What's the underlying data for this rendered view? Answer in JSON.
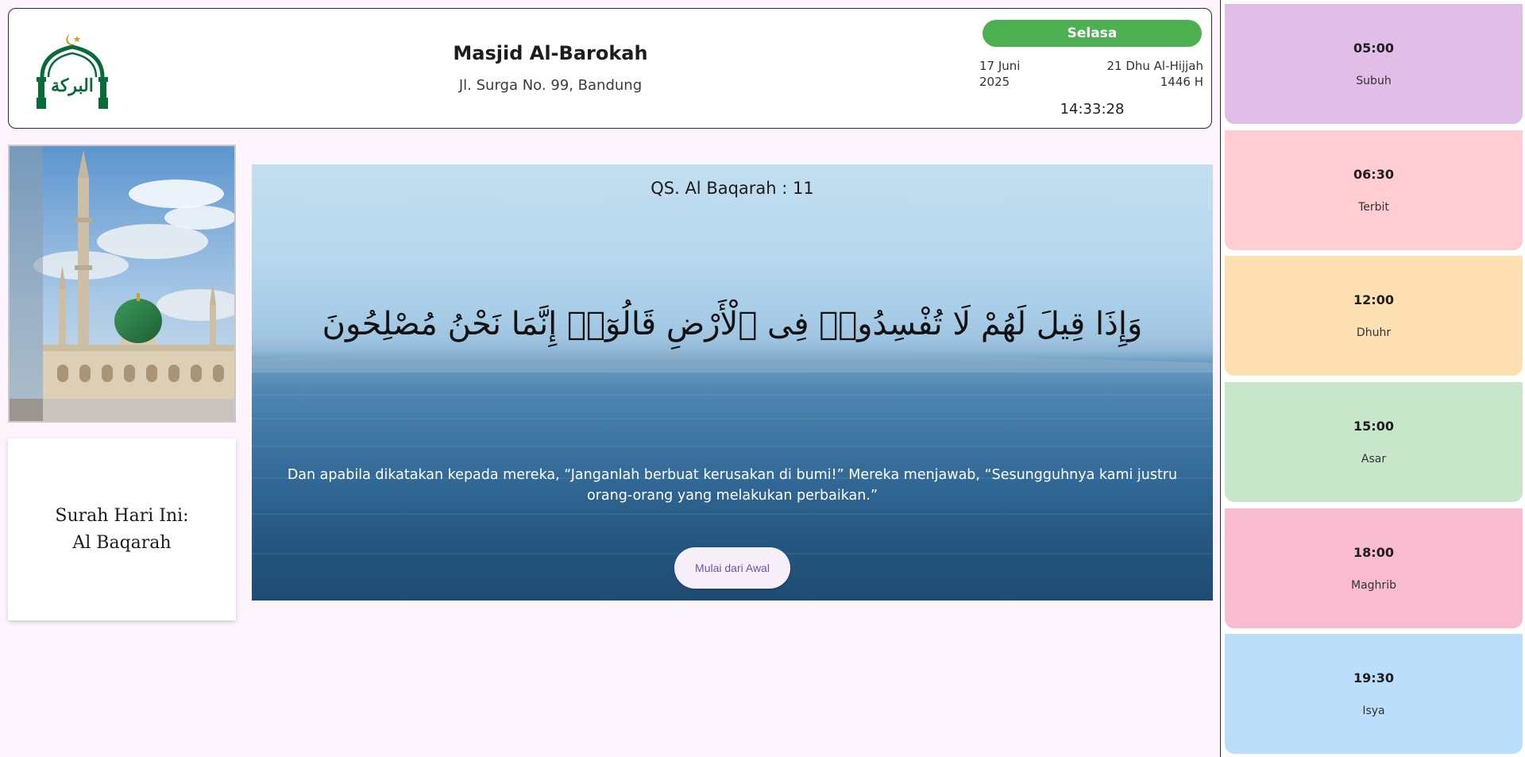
{
  "header": {
    "mosque_name": "Masjid Al-Barokah",
    "address": "Jl. Surga No. 99, Bandung",
    "day": "Selasa",
    "gregorian_date": [
      "17 Juni",
      "2025"
    ],
    "hijri_date": [
      "21 Dhu Al-Hijjah",
      "1446 H"
    ],
    "clock": "14:33:28",
    "logo_text": "البركة"
  },
  "surah_today": {
    "line1": "Surah Hari Ini:",
    "line2": "Al Baqarah"
  },
  "verse": {
    "reference": "QS. Al Baqarah : 11",
    "arabic": "وَإِذَا قِيلَ لَهُمْ لَا تُفْسِدُوا۟ فِى ٱلْأَرْضِ قَالُوٓا۟ إِنَّمَا نَحْنُ مُصْلِحُونَ",
    "translation": "Dan apabila dikatakan kepada mereka, “Janganlah berbuat kerusakan di bumi!” Mereka menjawab, “Sesungguhnya kami justru orang-orang yang melakukan perbaikan.”",
    "restart_label": "Mulai dari Awal"
  },
  "prayers": [
    {
      "time": "05:00",
      "name": "Subuh",
      "color": "#e1bee7"
    },
    {
      "time": "06:30",
      "name": "Terbit",
      "color": "#ffcdd2"
    },
    {
      "time": "12:00",
      "name": "Dhuhr",
      "color": "#ffe0b2"
    },
    {
      "time": "15:00",
      "name": "Asar",
      "color": "#c8e6c9"
    },
    {
      "time": "18:00",
      "name": "Maghrib",
      "color": "#f8bbd0"
    },
    {
      "time": "19:30",
      "name": "Isya",
      "color": "#bbdefb"
    }
  ],
  "colors": {
    "accent_green": "#4caf50",
    "logo_green": "#0a6b3a",
    "logo_gold": "#c9a227",
    "button_text": "#6b54a7"
  },
  "icons": {
    "logo": "mosque-dome-calligraphy-logo"
  }
}
